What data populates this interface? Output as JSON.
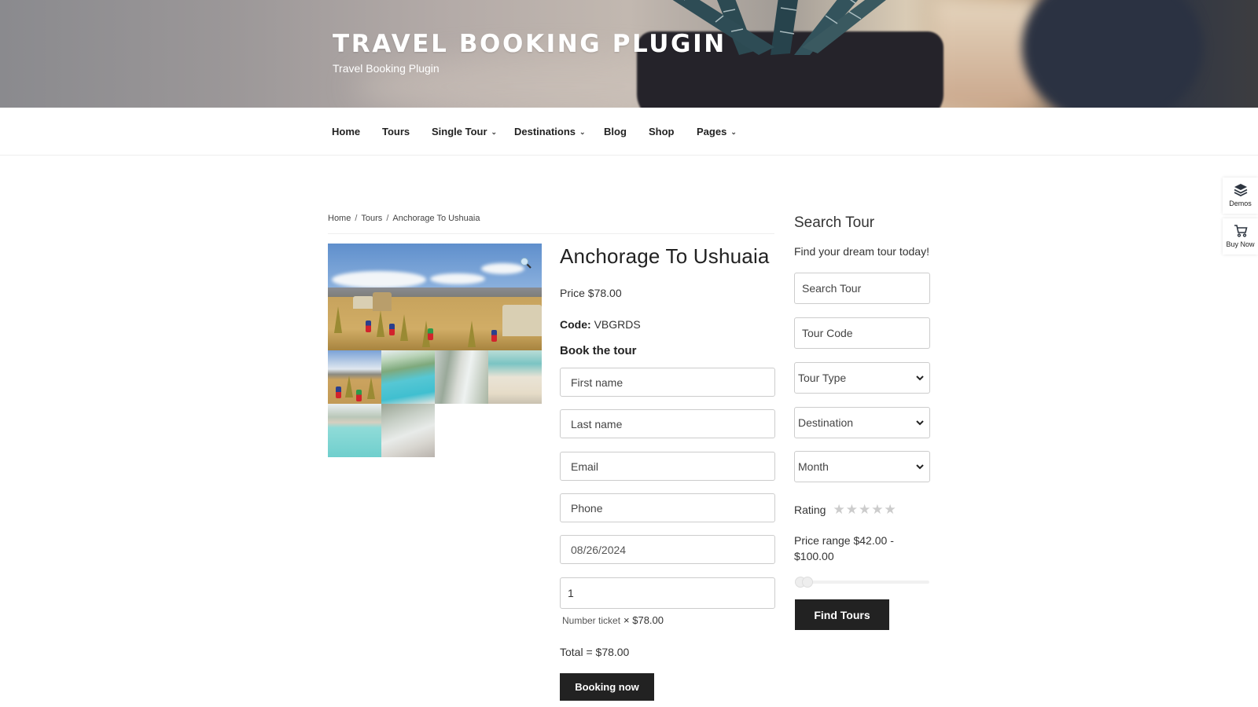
{
  "header": {
    "site_title": "TRAVEL BOOKING PLUGIN",
    "site_description": "Travel Booking Plugin"
  },
  "nav": {
    "items": [
      {
        "label": "Home",
        "has_dropdown": false
      },
      {
        "label": "Tours",
        "has_dropdown": false
      },
      {
        "label": "Single Tour",
        "has_dropdown": true
      },
      {
        "label": "Destinations",
        "has_dropdown": true
      },
      {
        "label": "Blog",
        "has_dropdown": false
      },
      {
        "label": "Shop",
        "has_dropdown": false
      },
      {
        "label": "Pages",
        "has_dropdown": true
      }
    ],
    "chevron": "⌄"
  },
  "side_buttons": {
    "demos": {
      "label": "Demos",
      "icon": "layers-icon"
    },
    "buy_now": {
      "label": "Buy Now",
      "icon": "cart-icon"
    }
  },
  "breadcrumb": {
    "items": [
      "Home",
      "Tours",
      "Anchorage To Ushuaia"
    ],
    "separator": "/"
  },
  "product": {
    "title": "Anchorage To Ushuaia",
    "price_text": "Price $78.00",
    "code_label": "Code:",
    "code_value": "VBGRDS",
    "gallery": {
      "main_image": "reed-island-village-photo",
      "zoom_icon": "magnifier-icon",
      "thumbnails": [
        "reed-island-village",
        "turquoise-bay",
        "coastal-boardwalk",
        "sandy-beach",
        "resort-pool",
        "beach-crowd"
      ]
    }
  },
  "booking_form": {
    "heading": "Book the tour",
    "first_name_placeholder": "First name",
    "last_name_placeholder": "Last name",
    "email_placeholder": "Email",
    "phone_placeholder": "Phone",
    "date_value": "08/26/2024",
    "tickets_value": "1",
    "ticket_label": "Number ticket",
    "ticket_price": "× $78.00",
    "total_text": "Total = $78.00",
    "submit_label": "Booking now"
  },
  "sidebar": {
    "title": "Search Tour",
    "subtitle": "Find your dream tour today!",
    "search_placeholder": "Search Tour",
    "code_placeholder": "Tour Code",
    "tour_type": "Tour Type",
    "destination": "Destination",
    "month": "Month",
    "rating_label": "Rating",
    "rating_value": 0,
    "rating_max": 5,
    "star_glyph": "★",
    "price_range_text": "Price range $42.00 - $100.00",
    "price_min": 42,
    "price_max": 100,
    "slider_low_fraction": 0.0,
    "slider_high_fraction": 0.05,
    "submit_label": "Find Tours"
  }
}
